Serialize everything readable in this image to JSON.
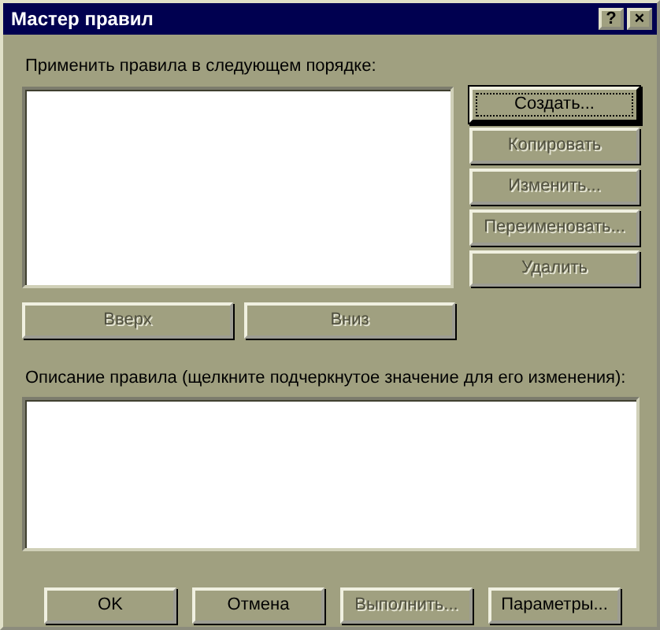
{
  "window": {
    "title": "Мастер правил"
  },
  "title_buttons": [
    {
      "kind": "help",
      "label": "?"
    },
    {
      "kind": "close",
      "label": "×"
    }
  ],
  "rules_label": "Применить правила в следующем порядке:",
  "side_buttons": [
    {
      "label": "Создать...",
      "disabled": false,
      "focused": true
    },
    {
      "label": "Копировать",
      "disabled": true,
      "focused": false
    },
    {
      "label": "Изменить...",
      "disabled": true,
      "focused": false
    },
    {
      "label": "Переименовать...",
      "disabled": true,
      "focused": false
    },
    {
      "label": "Удалить",
      "disabled": true,
      "focused": false
    }
  ],
  "move_buttons": [
    {
      "label": "Вверх",
      "disabled": true
    },
    {
      "label": "Вниз",
      "disabled": true
    }
  ],
  "description_label": "Описание правила (щелкните подчеркнутое значение для его изменения):",
  "bottom_buttons": [
    {
      "label": "OK",
      "disabled": false
    },
    {
      "label": "Отмена",
      "disabled": false
    },
    {
      "label": "Выполнить...",
      "disabled": true
    },
    {
      "label": "Параметры...",
      "disabled": false
    }
  ]
}
